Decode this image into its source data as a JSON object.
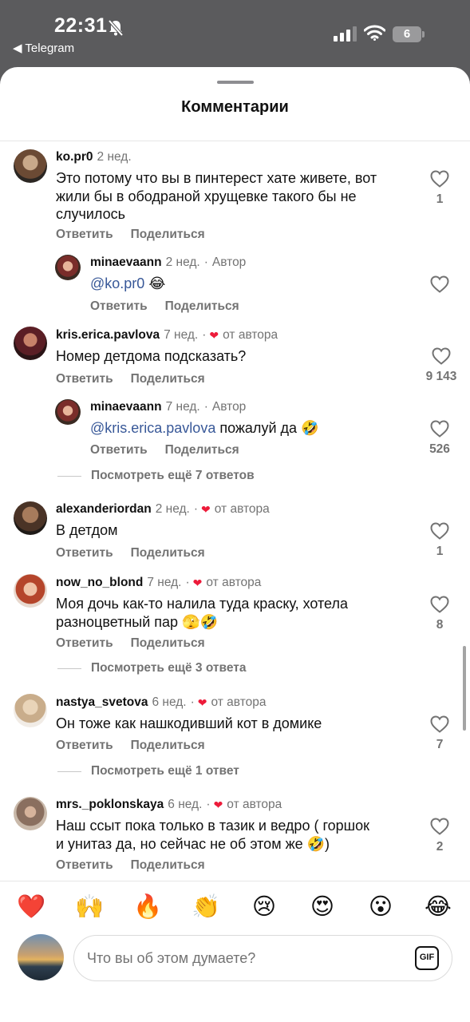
{
  "status_bar": {
    "time": "22:31",
    "back_label": "◀ Telegram",
    "battery": "6"
  },
  "sheet": {
    "title": "Комментарии"
  },
  "comments": [
    {
      "username": "ko.pr0",
      "time": "2 нед.",
      "text_lines": [
        "Это потому что вы в пинтерест хате живете, вот",
        "жили бы в ободраной хрущевке такого бы не",
        "случилось"
      ],
      "reply_label": "Ответить",
      "share_label": "Поделиться",
      "likes": "1"
    },
    {
      "username": "minaevaann",
      "time": "2 нед.",
      "tag": "Автор",
      "mention": "@ko.pr0",
      "text": " 😂",
      "reply_label": "Ответить",
      "share_label": "Поделиться"
    },
    {
      "username": "kris.erica.pavlova",
      "time": "7 нед.",
      "author_like": "от автора",
      "text": "Номер детдома подсказать?",
      "reply_label": "Ответить",
      "share_label": "Поделиться",
      "likes": "9 143"
    },
    {
      "username": "minaevaann",
      "time": "7 нед.",
      "tag": "Автор",
      "mention": "@kris.erica.pavlova",
      "text": " пожалуй да 🤣",
      "reply_label": "Ответить",
      "share_label": "Поделиться",
      "likes": "526"
    },
    {
      "username": "alexanderiordan",
      "time": "2 нед.",
      "author_like": "от автора",
      "text": "В детдом",
      "reply_label": "Ответить",
      "share_label": "Поделиться",
      "likes": "1"
    },
    {
      "username": "now_no_blond",
      "time": "7 нед.",
      "author_like": "от автора",
      "text_lines": [
        "Моя дочь как-то налила туда краску, хотела",
        "разноцветный пар 🫣🤣"
      ],
      "reply_label": "Ответить",
      "share_label": "Поделиться",
      "likes": "8"
    },
    {
      "username": "nastya_svetova",
      "time": "6 нед.",
      "author_like": "от автора",
      "text": "Он тоже как нашкодивший кот в домике",
      "reply_label": "Ответить",
      "share_label": "Поделиться",
      "likes": "7"
    },
    {
      "username": "mrs._poklonskaya",
      "time": "6 нед.",
      "author_like": "от автора",
      "text_lines": [
        "Наш ссыт пока только в тазик и ведро ( горшок",
        "и унитаз да, но сейчас не об этом же 🤣)"
      ],
      "reply_label": "Ответить",
      "share_label": "Поделиться",
      "likes": "2"
    }
  ],
  "more_replies": [
    "Посмотреть ещё 7 ответов",
    "Посмотреть ещё 3 ответа",
    "Посмотреть ещё 1 ответ"
  ],
  "reactions": [
    "❤️",
    "🙌",
    "🔥",
    "👏",
    "😢",
    "😍",
    "😮",
    "😂"
  ],
  "composer": {
    "placeholder": "Что вы об этом думаете?",
    "gif_label": "GIF"
  },
  "colors": {
    "author_heart": "#ed1b3a",
    "mention": "#385898",
    "sheet_bg": "#ffffff"
  }
}
